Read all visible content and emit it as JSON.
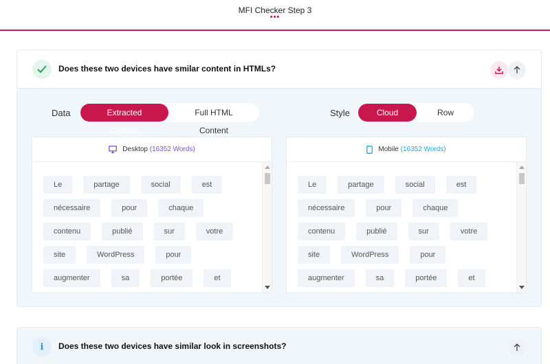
{
  "header": {
    "title": "MFI Checker Step 3",
    "dots": "•••"
  },
  "section1": {
    "question": "Does these two devices have smilar content in HTMLs?",
    "data_label": "Data",
    "data_options": [
      "Extracted Content",
      "Full HTML Content"
    ],
    "data_selected": "Extracted Content",
    "style_label": "Style",
    "style_options": [
      "Cloud",
      "Row"
    ],
    "style_selected": "Cloud",
    "desktop": {
      "label": "Desktop",
      "words": "(16352 Words)"
    },
    "mobile": {
      "label": "Mobile",
      "words": "(16352 Words)"
    },
    "word_rows": [
      [
        "Le",
        "partage",
        "social",
        "est"
      ],
      [
        "nécessaire",
        "pour",
        "chaque"
      ],
      [
        "contenu",
        "publié",
        "sur",
        "votre"
      ],
      [
        "site",
        "WordPress",
        "pour"
      ],
      [
        "augmenter",
        "sa",
        "portée",
        "et"
      ]
    ],
    "colors": {
      "accent": "#c8174d",
      "success": "#2e9e5b",
      "desktop_icon": "#7b4fd6",
      "mobile_icon": "#1fa9d9"
    }
  },
  "section2": {
    "icon_glyph": "i",
    "question": "Does these two devices have similar look in screenshots?"
  }
}
